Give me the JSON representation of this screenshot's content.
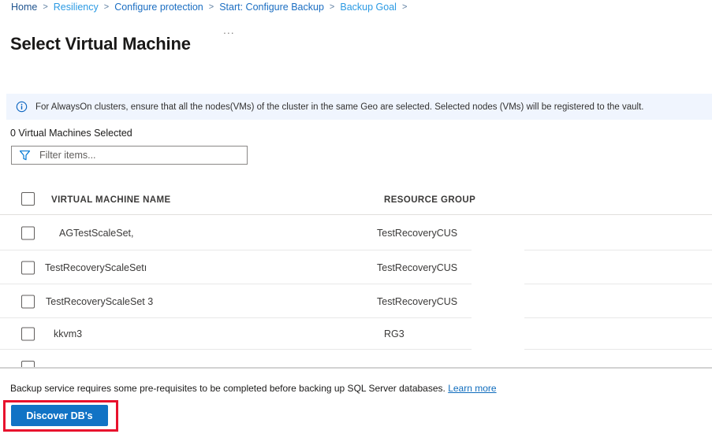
{
  "breadcrumb": {
    "separator": ">",
    "items": [
      {
        "label": "Home"
      },
      {
        "label": "Resiliency"
      },
      {
        "label": "Configure protection"
      },
      {
        "label": "Start: Configure Backup"
      },
      {
        "label": "Backup Goal"
      }
    ]
  },
  "page": {
    "title": "Select Virtual Machine",
    "more_menu": "..."
  },
  "banner": {
    "icon": "info-icon",
    "text": "For AlwaysOn clusters, ensure that all the nodes(VMs) of the cluster in the same Geo are selected. Selected nodes (VMs) will be registered to the vault."
  },
  "selection": {
    "summary": "0 Virtual Machines Selected"
  },
  "filter": {
    "icon": "filter-funnel-icon",
    "placeholder": "Filter items...",
    "value": ""
  },
  "table": {
    "columns": [
      "VIRTUAL MACHINE NAME",
      "RESOURCE GROUP"
    ],
    "rows": [
      {
        "name": "AGTestScaleSet",
        "suffix": ",",
        "resource_group": "TestRecoveryCUS",
        "selected": false
      },
      {
        "name": "TestRecoveryScaleSet",
        "suffix": "ı",
        "resource_group": "TestRecoveryCUS",
        "selected": false
      },
      {
        "name": "TestRecoveryScaleSet 3",
        "suffix": "",
        "resource_group": "TestRecoveryCUS",
        "selected": false
      },
      {
        "name": "kkvm3",
        "suffix": "",
        "resource_group": "RG3",
        "selected": false
      }
    ],
    "partial_next_row": true
  },
  "footer": {
    "note": "Backup service requires some pre-requisites to be completed before backing up SQL Server databases.",
    "link": "Learn more",
    "button": "Discover DB's"
  },
  "colors": {
    "accent": "#0078d4",
    "button_blue": "#1173c5",
    "annotation_red": "#e8112d",
    "banner_bg": "#f0f5fe",
    "link_blue": "#0f6cbd"
  }
}
